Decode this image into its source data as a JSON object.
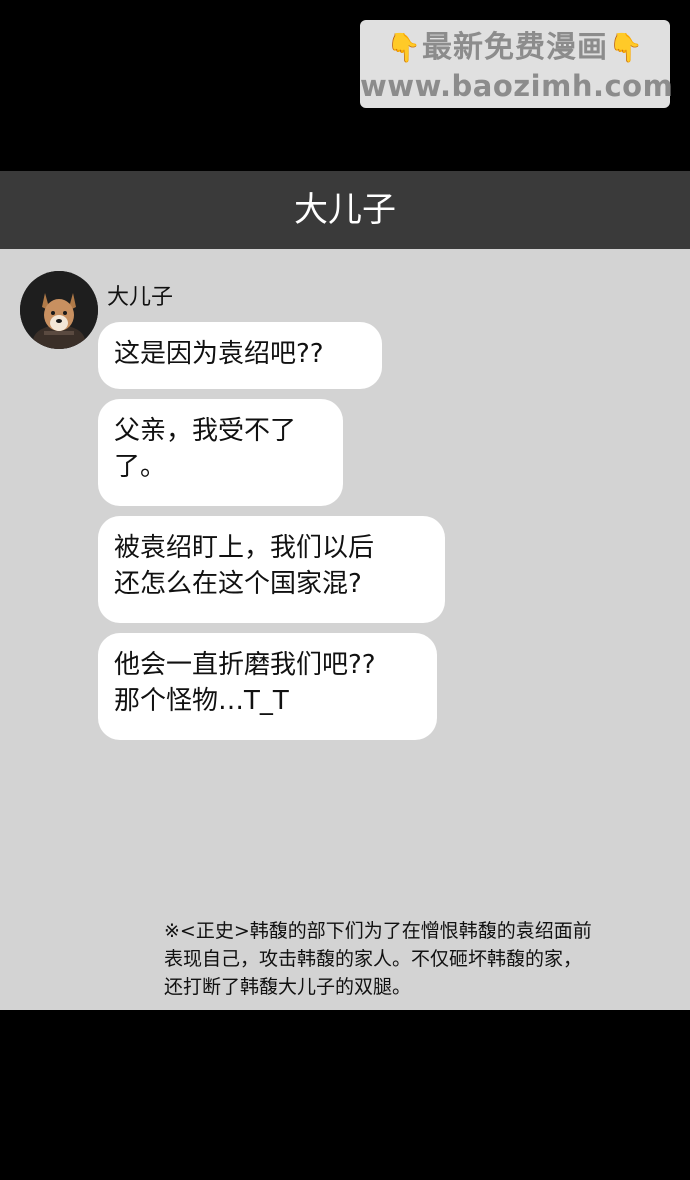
{
  "watermark": {
    "line1": "最新免费漫画",
    "line2": "www.baozimh.com",
    "hand_icon_left": "👇",
    "hand_icon_right": "👇"
  },
  "header": {
    "title": "大儿子"
  },
  "conversation": {
    "sender_name": "大儿子",
    "avatar_icon": "dog-avatar",
    "messages": [
      "这是因为袁绍吧??",
      "父亲，我受不了\n了。",
      "被袁绍盯上，我们以后\n还怎么在这个国家混?",
      "他会一直折磨我们吧??\n那个怪物…T_T"
    ]
  },
  "footnote": "※<正史>韩馥的部下们为了在憎恨韩馥的袁绍面前\n表现自己，攻击韩馥的家人。不仅砸坏韩馥的家，\n还打断了韩馥大儿子的双腿。",
  "colors": {
    "page_background": "#000000",
    "header_background": "#3a3a3a",
    "chat_background": "#d3d3d3",
    "bubble_background": "#ffffff"
  }
}
